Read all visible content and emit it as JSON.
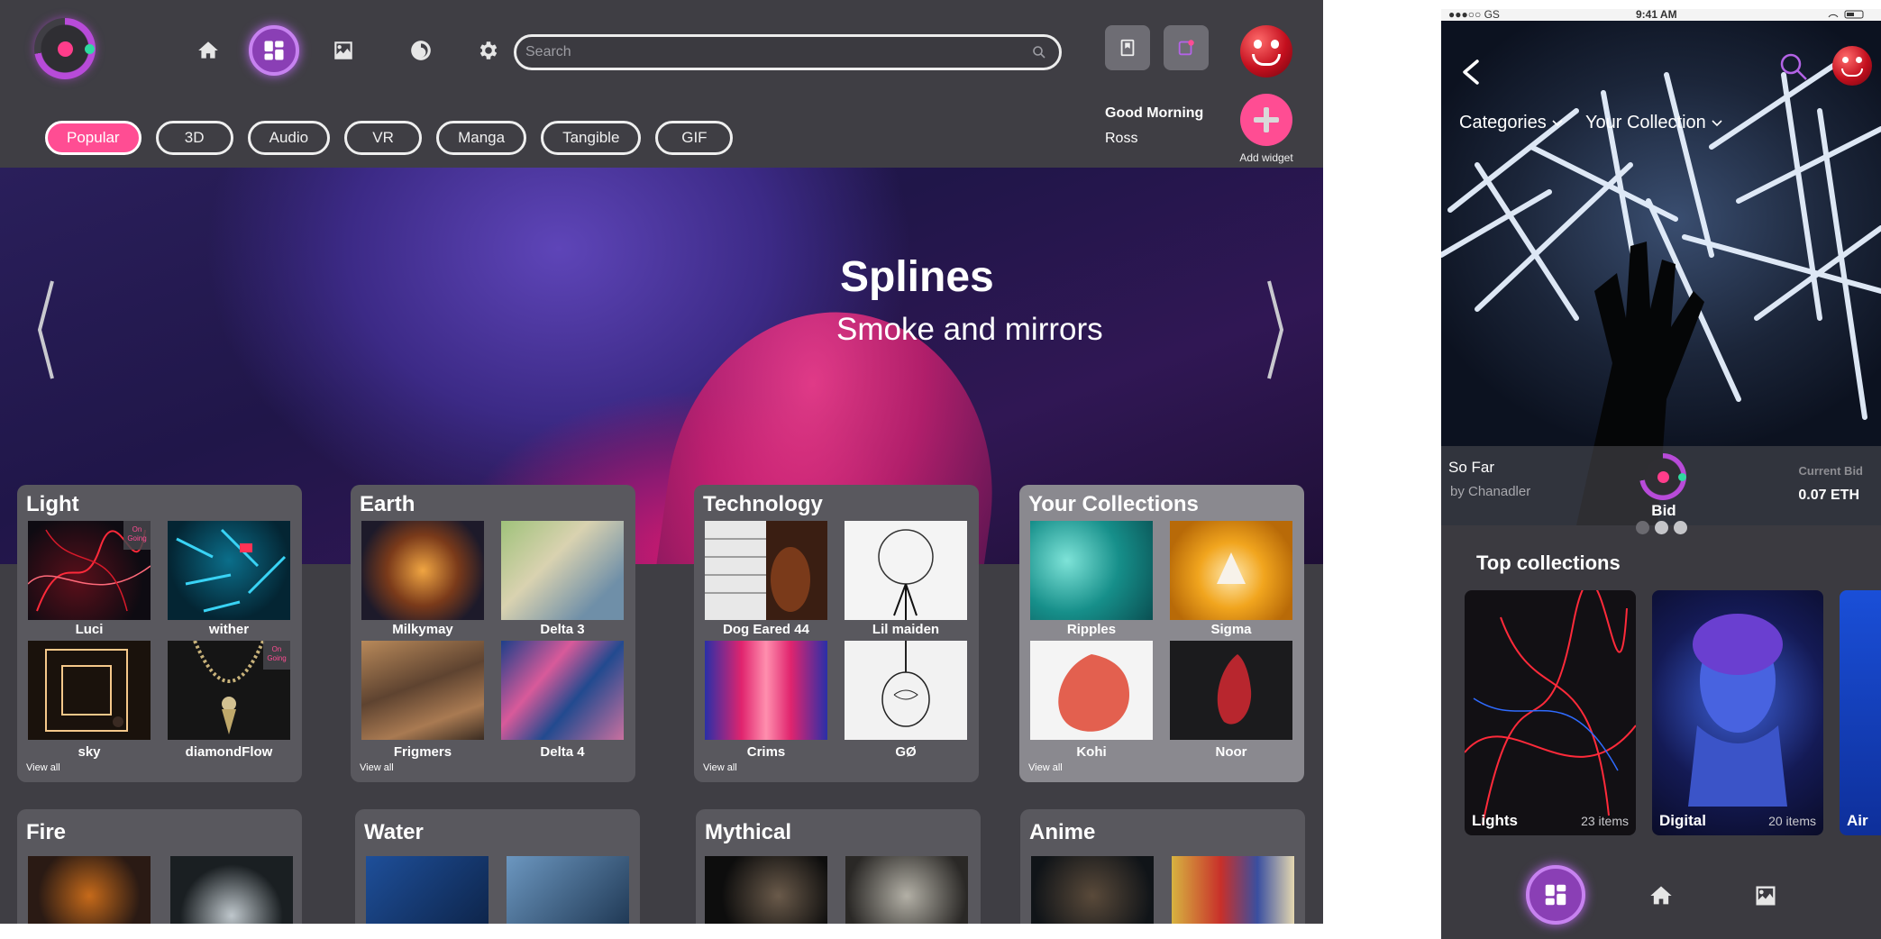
{
  "desktop": {
    "search": {
      "placeholder": "Search"
    },
    "tags": [
      "Popular",
      "3D",
      "Audio",
      "VR",
      "Manga",
      "Tangible",
      "GIF"
    ],
    "greeting": {
      "line1": "Good Morning",
      "line2": "Ross"
    },
    "add_widget_label": "Add widget",
    "hero": {
      "title": "Splines",
      "subtitle": "Smoke and mirrors"
    },
    "cards": [
      {
        "title": "Light",
        "items": [
          "Luci",
          "wither",
          "sky",
          "diamondFlow"
        ],
        "view_all": "View all",
        "ongoing": "On Going"
      },
      {
        "title": "Earth",
        "items": [
          "Milkymay",
          "Delta 3",
          "Frigmers",
          "Delta 4"
        ],
        "view_all": "View all"
      },
      {
        "title": "Technology",
        "items": [
          "Dog Eared 44",
          "Lil maiden",
          "Crims",
          "GØ"
        ],
        "view_all": "View all"
      },
      {
        "title": "Your Collections",
        "items": [
          "Ripples",
          "Sigma",
          "Kohi",
          "Noor"
        ],
        "view_all": "View all"
      }
    ],
    "cards_row2": [
      "Fire",
      "Water",
      "Mythical",
      "Anime"
    ]
  },
  "phone": {
    "status": {
      "carrier": "●●●○○ GS",
      "time": "9:41 AM"
    },
    "dropdowns": [
      "Categories",
      "Your Collection"
    ],
    "featured": {
      "title": "So Far",
      "by": "by Chanadler",
      "bid_label": "Bid",
      "current_bid_label": "Current Bid",
      "current_bid": "0.07 ETH"
    },
    "top_collections_title": "Top collections",
    "collections": [
      {
        "name": "Lights",
        "count": "23 items"
      },
      {
        "name": "Digital",
        "count": "20 items"
      },
      {
        "name": "Air",
        "count": ""
      }
    ]
  },
  "colors": {
    "accent_pink": "#ff4d93",
    "accent_purple": "#8a3fb5",
    "panel": "#3f3e44"
  },
  "icons": [
    "logo",
    "home-icon",
    "dashboard-icon",
    "image-icon",
    "history-icon",
    "gear-icon",
    "search-icon",
    "bookmark-icon",
    "notification-icon",
    "avatar",
    "plus-icon",
    "chevron-left-icon",
    "chevron-right-icon",
    "back-icon",
    "chevron-down-icon"
  ]
}
